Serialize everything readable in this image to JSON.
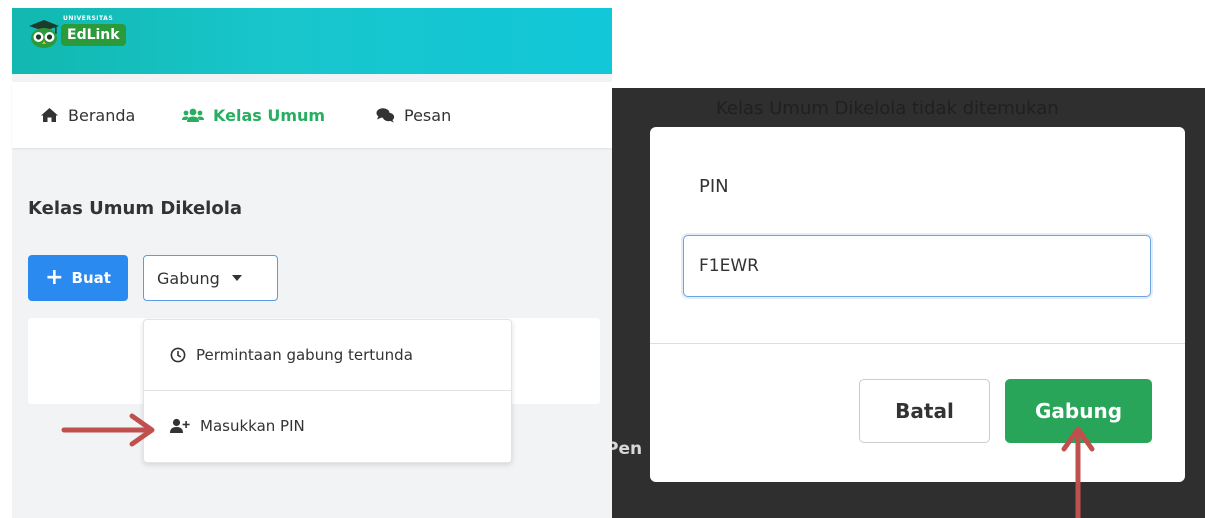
{
  "app": {
    "brand_small": "UNIVERSITAS",
    "brand": "EdLink"
  },
  "nav": {
    "items": [
      {
        "label": "Beranda",
        "icon": "home-icon",
        "active": false
      },
      {
        "label": "Kelas Umum",
        "icon": "users-icon",
        "active": true
      },
      {
        "label": "Pesan",
        "icon": "comments-icon",
        "active": false
      }
    ],
    "active_color": "#27ae60"
  },
  "section": {
    "title": "Kelas Umum Dikelola"
  },
  "actions": {
    "create_label": "Buat",
    "join_label": "Gabung"
  },
  "dropdown": {
    "items": [
      {
        "label": "Permintaan gabung tertunda",
        "icon": "clock-icon"
      },
      {
        "label": "Masukkan PIN",
        "icon": "user-plus-icon"
      }
    ]
  },
  "modal_background": {
    "empty_message": "Kelas Umum Dikelola tidak ditemukan",
    "partial_text": "Pen"
  },
  "modal": {
    "pin_label": "PIN",
    "pin_value": "F1EWR",
    "cancel_label": "Batal",
    "join_label": "Gabung"
  },
  "colors": {
    "primary": "#2a8af0",
    "success": "#29a559",
    "arrow": "#c0504d",
    "header_start": "#12b8b0",
    "header_end": "#12c7d8"
  }
}
